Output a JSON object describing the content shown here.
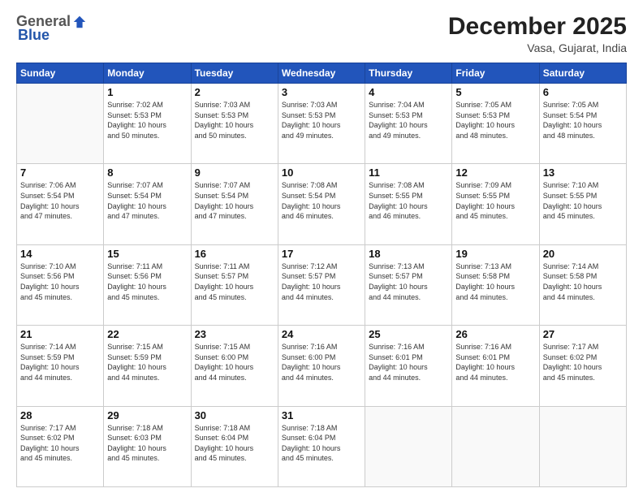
{
  "logo": {
    "general": "General",
    "blue": "Blue"
  },
  "header": {
    "month_year": "December 2025",
    "location": "Vasa, Gujarat, India"
  },
  "weekdays": [
    "Sunday",
    "Monday",
    "Tuesday",
    "Wednesday",
    "Thursday",
    "Friday",
    "Saturday"
  ],
  "weeks": [
    [
      {
        "day": "",
        "info": ""
      },
      {
        "day": "1",
        "info": "Sunrise: 7:02 AM\nSunset: 5:53 PM\nDaylight: 10 hours\nand 50 minutes."
      },
      {
        "day": "2",
        "info": "Sunrise: 7:03 AM\nSunset: 5:53 PM\nDaylight: 10 hours\nand 50 minutes."
      },
      {
        "day": "3",
        "info": "Sunrise: 7:03 AM\nSunset: 5:53 PM\nDaylight: 10 hours\nand 49 minutes."
      },
      {
        "day": "4",
        "info": "Sunrise: 7:04 AM\nSunset: 5:53 PM\nDaylight: 10 hours\nand 49 minutes."
      },
      {
        "day": "5",
        "info": "Sunrise: 7:05 AM\nSunset: 5:53 PM\nDaylight: 10 hours\nand 48 minutes."
      },
      {
        "day": "6",
        "info": "Sunrise: 7:05 AM\nSunset: 5:54 PM\nDaylight: 10 hours\nand 48 minutes."
      }
    ],
    [
      {
        "day": "7",
        "info": "Sunrise: 7:06 AM\nSunset: 5:54 PM\nDaylight: 10 hours\nand 47 minutes."
      },
      {
        "day": "8",
        "info": "Sunrise: 7:07 AM\nSunset: 5:54 PM\nDaylight: 10 hours\nand 47 minutes."
      },
      {
        "day": "9",
        "info": "Sunrise: 7:07 AM\nSunset: 5:54 PM\nDaylight: 10 hours\nand 47 minutes."
      },
      {
        "day": "10",
        "info": "Sunrise: 7:08 AM\nSunset: 5:54 PM\nDaylight: 10 hours\nand 46 minutes."
      },
      {
        "day": "11",
        "info": "Sunrise: 7:08 AM\nSunset: 5:55 PM\nDaylight: 10 hours\nand 46 minutes."
      },
      {
        "day": "12",
        "info": "Sunrise: 7:09 AM\nSunset: 5:55 PM\nDaylight: 10 hours\nand 45 minutes."
      },
      {
        "day": "13",
        "info": "Sunrise: 7:10 AM\nSunset: 5:55 PM\nDaylight: 10 hours\nand 45 minutes."
      }
    ],
    [
      {
        "day": "14",
        "info": "Sunrise: 7:10 AM\nSunset: 5:56 PM\nDaylight: 10 hours\nand 45 minutes."
      },
      {
        "day": "15",
        "info": "Sunrise: 7:11 AM\nSunset: 5:56 PM\nDaylight: 10 hours\nand 45 minutes."
      },
      {
        "day": "16",
        "info": "Sunrise: 7:11 AM\nSunset: 5:57 PM\nDaylight: 10 hours\nand 45 minutes."
      },
      {
        "day": "17",
        "info": "Sunrise: 7:12 AM\nSunset: 5:57 PM\nDaylight: 10 hours\nand 44 minutes."
      },
      {
        "day": "18",
        "info": "Sunrise: 7:13 AM\nSunset: 5:57 PM\nDaylight: 10 hours\nand 44 minutes."
      },
      {
        "day": "19",
        "info": "Sunrise: 7:13 AM\nSunset: 5:58 PM\nDaylight: 10 hours\nand 44 minutes."
      },
      {
        "day": "20",
        "info": "Sunrise: 7:14 AM\nSunset: 5:58 PM\nDaylight: 10 hours\nand 44 minutes."
      }
    ],
    [
      {
        "day": "21",
        "info": "Sunrise: 7:14 AM\nSunset: 5:59 PM\nDaylight: 10 hours\nand 44 minutes."
      },
      {
        "day": "22",
        "info": "Sunrise: 7:15 AM\nSunset: 5:59 PM\nDaylight: 10 hours\nand 44 minutes."
      },
      {
        "day": "23",
        "info": "Sunrise: 7:15 AM\nSunset: 6:00 PM\nDaylight: 10 hours\nand 44 minutes."
      },
      {
        "day": "24",
        "info": "Sunrise: 7:16 AM\nSunset: 6:00 PM\nDaylight: 10 hours\nand 44 minutes."
      },
      {
        "day": "25",
        "info": "Sunrise: 7:16 AM\nSunset: 6:01 PM\nDaylight: 10 hours\nand 44 minutes."
      },
      {
        "day": "26",
        "info": "Sunrise: 7:16 AM\nSunset: 6:01 PM\nDaylight: 10 hours\nand 44 minutes."
      },
      {
        "day": "27",
        "info": "Sunrise: 7:17 AM\nSunset: 6:02 PM\nDaylight: 10 hours\nand 45 minutes."
      }
    ],
    [
      {
        "day": "28",
        "info": "Sunrise: 7:17 AM\nSunset: 6:02 PM\nDaylight: 10 hours\nand 45 minutes."
      },
      {
        "day": "29",
        "info": "Sunrise: 7:18 AM\nSunset: 6:03 PM\nDaylight: 10 hours\nand 45 minutes."
      },
      {
        "day": "30",
        "info": "Sunrise: 7:18 AM\nSunset: 6:04 PM\nDaylight: 10 hours\nand 45 minutes."
      },
      {
        "day": "31",
        "info": "Sunrise: 7:18 AM\nSunset: 6:04 PM\nDaylight: 10 hours\nand 45 minutes."
      },
      {
        "day": "",
        "info": ""
      },
      {
        "day": "",
        "info": ""
      },
      {
        "day": "",
        "info": ""
      }
    ]
  ]
}
